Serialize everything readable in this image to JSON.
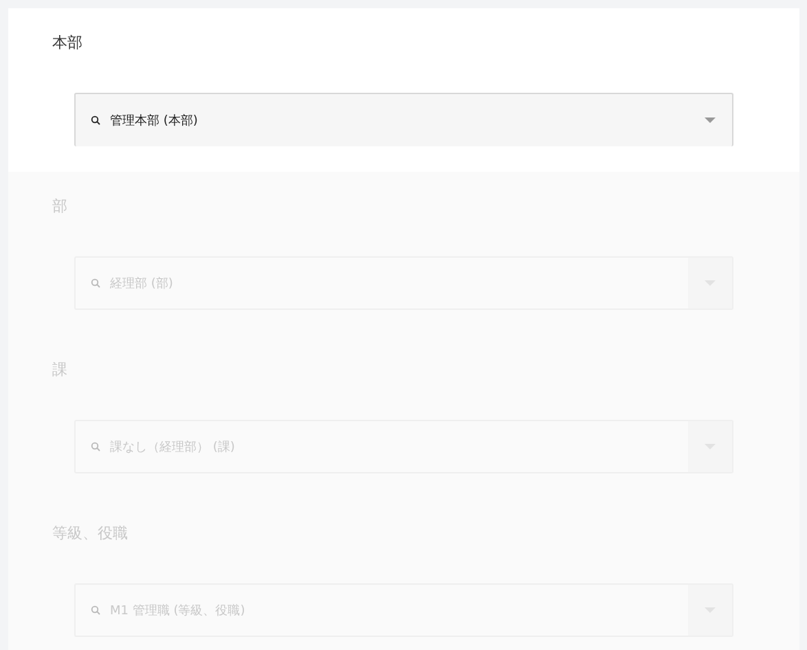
{
  "fields": [
    {
      "label": "本部",
      "value": "管理本部 (本部)",
      "disabled": false
    },
    {
      "label": "部",
      "value": "経理部 (部)",
      "disabled": true
    },
    {
      "label": "課",
      "value": "課なし（経理部） (課)",
      "disabled": true
    },
    {
      "label": "等級、役職",
      "value": "M1 管理職 (等級、役職)",
      "disabled": true
    }
  ]
}
